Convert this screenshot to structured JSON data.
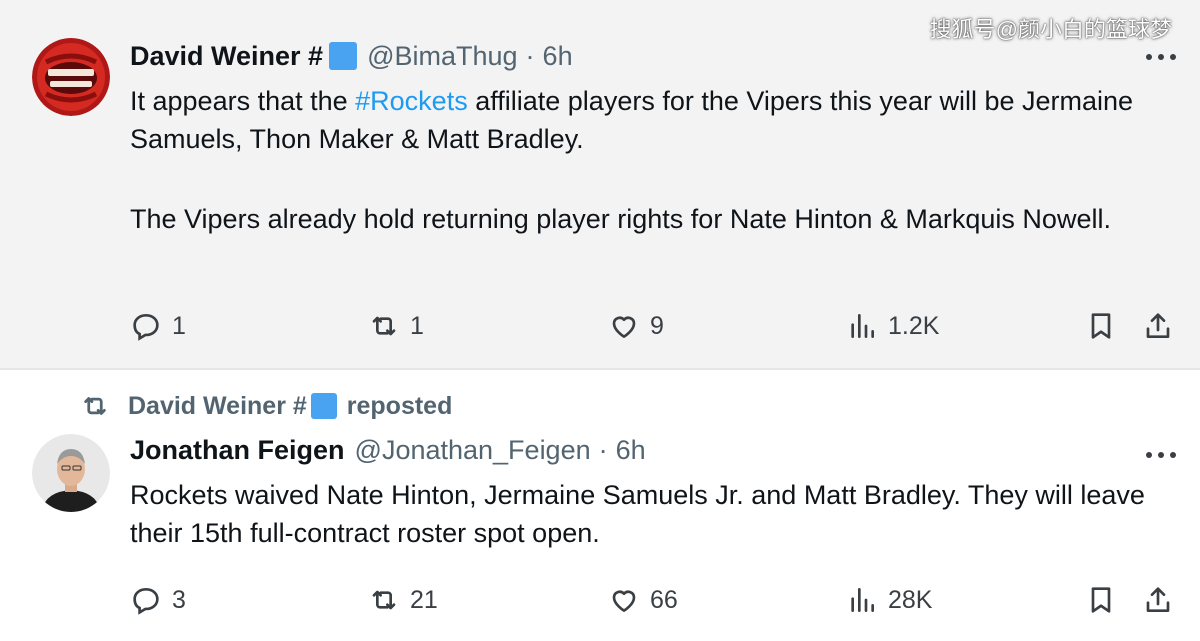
{
  "watermark": "搜狐号@颜小白的篮球梦",
  "tweets": [
    {
      "author_name": "David Weiner #",
      "handle": "@BimaThug",
      "separator": "·",
      "time": "6h",
      "text_before_hashtag": "It appears that the ",
      "hashtag": "#Rockets",
      "text_after_hashtag": " affiliate players for the Vipers this year will be Jermaine Samuels, Thon Maker & Matt Bradley.",
      "paragraph_2": "The Vipers already hold returning player rights for Nate Hinton & Markquis Nowell.",
      "replies": "1",
      "reposts": "1",
      "likes": "9",
      "views": "1.2K"
    },
    {
      "repost_by": "David Weiner #",
      "repost_label": "reposted",
      "author_name": "Jonathan Feigen",
      "handle": "@Jonathan_Feigen",
      "separator": "·",
      "time": "6h",
      "text": "Rockets waived Nate Hinton, Jermaine Samuels Jr. and Matt Bradley. They will leave their 15th full-contract roster spot open.",
      "replies": "3",
      "reposts": "21",
      "likes": "66",
      "views": "28K"
    }
  ],
  "colors": {
    "hashtag": "#1d9bf0",
    "verified_badge": "#4aa3f0",
    "secondary_text": "#536471",
    "tweet1_background": "#f3f3f4"
  },
  "icons": [
    "reply-icon",
    "repost-icon",
    "like-icon",
    "views-icon",
    "bookmark-icon",
    "share-icon",
    "more-icon",
    "verified-badge-icon"
  ]
}
